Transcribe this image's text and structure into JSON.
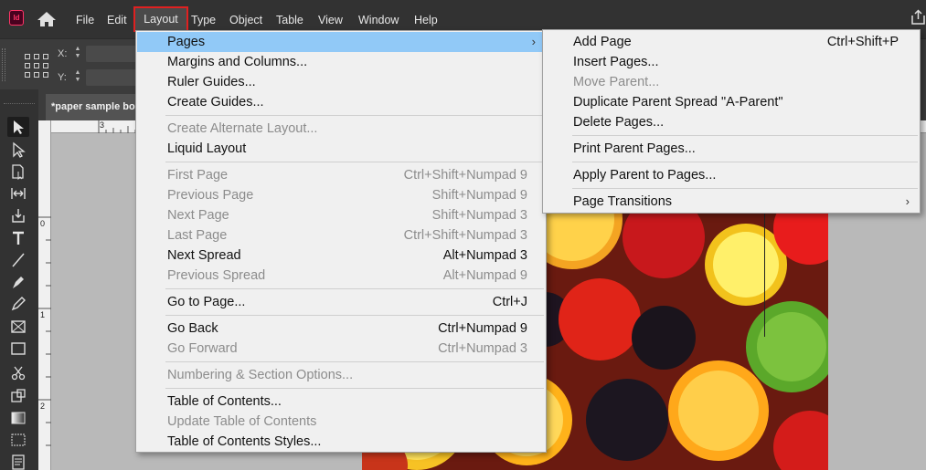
{
  "app": {
    "logo_text": "Id",
    "accent_color": "#ff3366",
    "highlight_color": "#91c9f7",
    "active_menu_border_color": "#e02020"
  },
  "menubar": {
    "items": [
      {
        "label": "File"
      },
      {
        "label": "Edit"
      },
      {
        "label": "Layout"
      },
      {
        "label": "Type"
      },
      {
        "label": "Object"
      },
      {
        "label": "Table"
      },
      {
        "label": "View"
      },
      {
        "label": "Window"
      },
      {
        "label": "Help"
      }
    ]
  },
  "controlbar": {
    "x_label": "X:",
    "y_label": "Y:"
  },
  "document_tab": {
    "title": "*paper sample book"
  },
  "rulers": {
    "top_ticks": [
      "3"
    ],
    "left_ticks": [
      "0",
      "1",
      "2"
    ]
  },
  "layout_menu": {
    "items": [
      {
        "label": "Pages",
        "shortcut": "",
        "disabled": false,
        "highlighted": true,
        "submenu": true
      },
      {
        "label": "Margins and Columns...",
        "shortcut": "",
        "disabled": false
      },
      {
        "label": "Ruler Guides...",
        "shortcut": "",
        "disabled": false
      },
      {
        "label": "Create Guides...",
        "shortcut": "",
        "disabled": false
      },
      {
        "label": "Create Alternate Layout...",
        "shortcut": "",
        "disabled": true
      },
      {
        "label": "Liquid Layout",
        "shortcut": "",
        "disabled": false
      },
      {
        "label": "First Page",
        "shortcut": "Ctrl+Shift+Numpad 9",
        "disabled": true
      },
      {
        "label": "Previous Page",
        "shortcut": "Shift+Numpad 9",
        "disabled": true
      },
      {
        "label": "Next Page",
        "shortcut": "Shift+Numpad 3",
        "disabled": true
      },
      {
        "label": "Last Page",
        "shortcut": "Ctrl+Shift+Numpad 3",
        "disabled": true
      },
      {
        "label": "Next Spread",
        "shortcut": "Alt+Numpad 3",
        "disabled": false
      },
      {
        "label": "Previous Spread",
        "shortcut": "Alt+Numpad 9",
        "disabled": true
      },
      {
        "label": "Go to Page...",
        "shortcut": "Ctrl+J",
        "disabled": false
      },
      {
        "label": "Go Back",
        "shortcut": "Ctrl+Numpad 9",
        "disabled": false
      },
      {
        "label": "Go Forward",
        "shortcut": "Ctrl+Numpad 3",
        "disabled": true
      },
      {
        "label": "Numbering & Section Options...",
        "shortcut": "",
        "disabled": true
      },
      {
        "label": "Table of Contents...",
        "shortcut": "",
        "disabled": false
      },
      {
        "label": "Update Table of Contents",
        "shortcut": "",
        "disabled": true
      },
      {
        "label": "Table of Contents Styles...",
        "shortcut": "",
        "disabled": false
      }
    ]
  },
  "pages_submenu": {
    "items": [
      {
        "label": "Add Page",
        "shortcut": "Ctrl+Shift+P",
        "disabled": false
      },
      {
        "label": "Insert Pages...",
        "shortcut": "",
        "disabled": false
      },
      {
        "label": "Move Parent...",
        "shortcut": "",
        "disabled": true
      },
      {
        "label": "Duplicate Parent Spread \"A-Parent\"",
        "shortcut": "",
        "disabled": false
      },
      {
        "label": "Delete Pages...",
        "shortcut": "",
        "disabled": false
      },
      {
        "label": "Print Parent Pages...",
        "shortcut": "",
        "disabled": false
      },
      {
        "label": "Apply Parent to Pages...",
        "shortcut": "",
        "disabled": false
      },
      {
        "label": "Page Transitions",
        "shortcut": "",
        "disabled": false,
        "submenu": true
      }
    ]
  },
  "icons": {
    "arrow_glyph": "›",
    "tools": [
      "selection-tool-icon",
      "direct-selection-tool-icon",
      "page-tool-icon",
      "gap-tool-icon",
      "content-collector-icon",
      "type-tool-icon",
      "line-tool-icon",
      "pen-tool-icon",
      "pencil-tool-icon",
      "rectangle-frame-icon",
      "rectangle-tool-icon",
      "scissors-icon",
      "free-transform-icon",
      "gradient-swatch-icon",
      "gradient-feather-icon",
      "note-tool-icon"
    ]
  }
}
